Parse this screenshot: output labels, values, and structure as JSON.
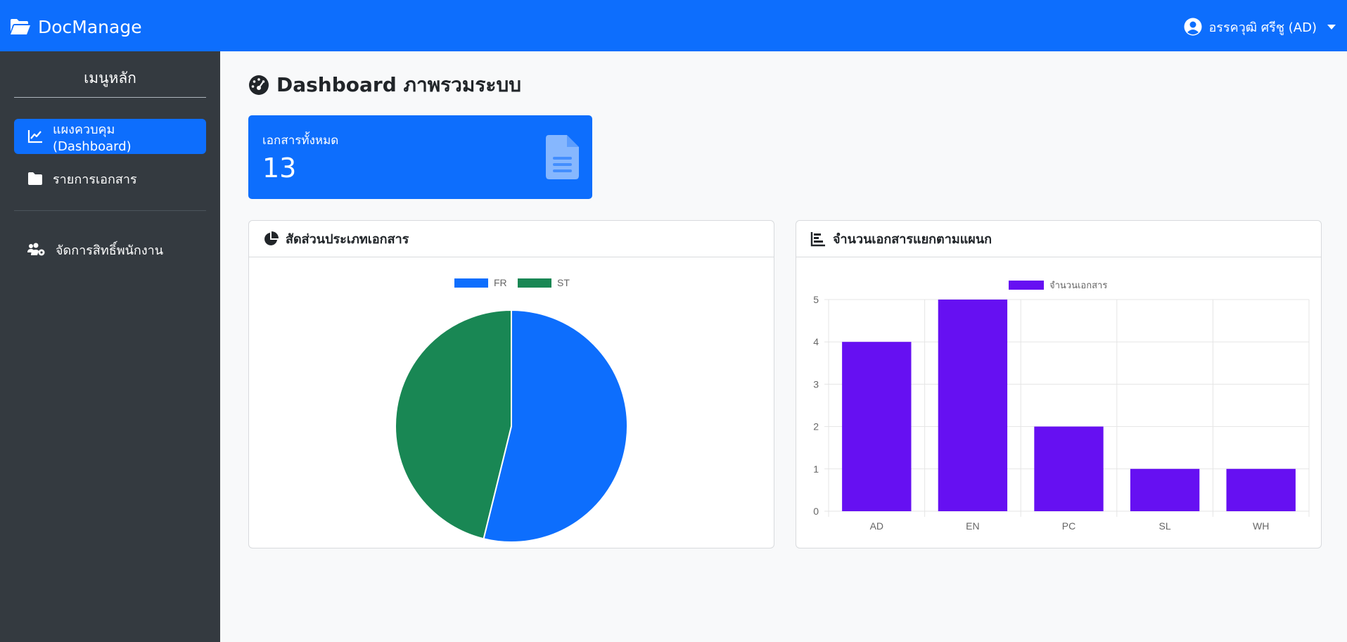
{
  "app": {
    "brand": "DocManage"
  },
  "user": {
    "name": "อรรควุฒิ ศรีชู (AD)"
  },
  "sidebar": {
    "title": "เมนูหลัก",
    "items": [
      {
        "label": "แผงควบคุม (Dashboard)",
        "icon": "chart-line-icon",
        "active": true
      },
      {
        "label": "รายการเอกสาร",
        "icon": "folder-icon",
        "active": false
      },
      {
        "label": "จัดการสิทธิ์พนักงาน",
        "icon": "users-cog-icon",
        "active": false
      }
    ]
  },
  "page": {
    "title": "Dashboard ภาพรวมระบบ"
  },
  "stat": {
    "label": "เอกสารทั้งหมด",
    "value": "13"
  },
  "cards": {
    "pie_title": "สัดส่วนประเภทเอกสาร",
    "bar_title": "จำนวนเอกสารแยกตามแผนก"
  },
  "colors": {
    "primary": "#0d6efd",
    "green": "#198754",
    "purple": "#6610f2",
    "sidebar": "#343a40"
  },
  "chart_data": [
    {
      "type": "pie",
      "categories": [
        "FR",
        "ST"
      ],
      "values": [
        7,
        6
      ],
      "colors": [
        "#0d6efd",
        "#198754"
      ],
      "legend": "top"
    },
    {
      "type": "bar",
      "categories": [
        "AD",
        "EN",
        "PC",
        "SL",
        "WH"
      ],
      "series": [
        {
          "name": "จำนวนเอกสาร",
          "values": [
            4,
            5,
            2,
            1,
            1
          ]
        }
      ],
      "ylim": [
        0,
        5
      ],
      "yticks": [
        0,
        1,
        2,
        3,
        4,
        5
      ],
      "grid": true,
      "legend": "top",
      "color": "#6610f2"
    }
  ]
}
